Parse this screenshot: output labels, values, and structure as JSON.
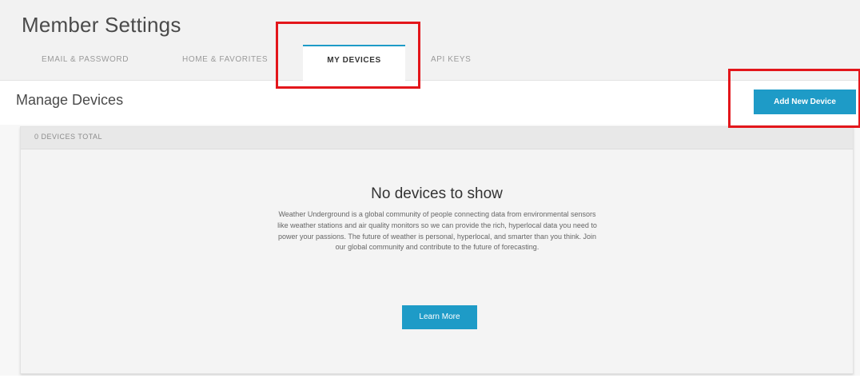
{
  "header": {
    "title": "Member Settings",
    "tabs": [
      {
        "label": "EMAIL & PASSWORD"
      },
      {
        "label": "HOME & FAVORITES"
      },
      {
        "label": "MY DEVICES"
      },
      {
        "label": "API KEYS"
      }
    ],
    "active_tab": "MY DEVICES"
  },
  "section": {
    "title": "Manage Devices",
    "add_button_label": "Add New Device"
  },
  "panel": {
    "count_label": "0 DEVICES TOTAL",
    "empty_title": "No devices to show",
    "empty_text": "Weather Underground is a global community of people connecting data from environmental sensors like weather stations and air quality monitors so we can provide the rich, hyperlocal data you need to power your passions. The future of weather is personal, hyperlocal, and smarter than you think. Join our global community and contribute to the future of forecasting.",
    "learn_button_label": "Learn More"
  },
  "colors": {
    "accent": "#1e9bc7",
    "highlight": "#e3161b"
  }
}
